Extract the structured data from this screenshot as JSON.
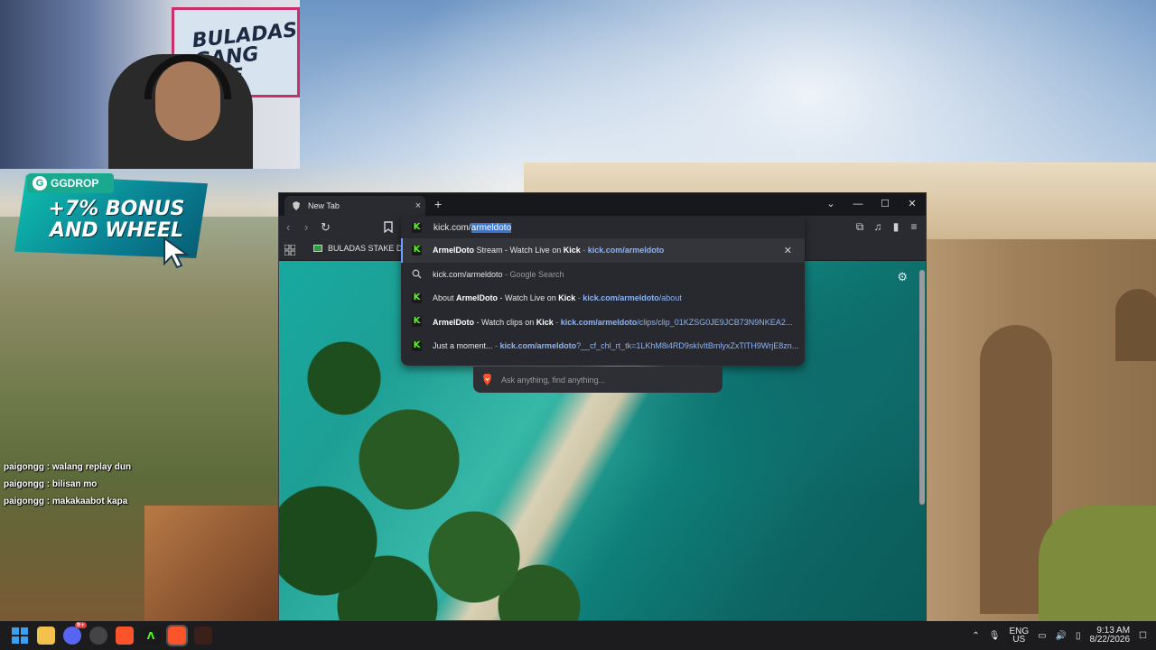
{
  "overlay": {
    "promo_brand": "GGDROP",
    "promo_text": "+7% BONUS AND WHEEL",
    "webcam_graffiti": "BULADAS GANG LIFE",
    "chat": [
      {
        "user": "paigongg",
        "message": "walang replay dun"
      },
      {
        "user": "paigongg",
        "message": "bilisan mo"
      },
      {
        "user": "paigongg",
        "message": "makakaabot kapa"
      }
    ]
  },
  "browser": {
    "tab_title": "New Tab",
    "tab_close": "×",
    "new_tab": "+",
    "window_controls": [
      "⌄",
      "—",
      "☐",
      "✕"
    ],
    "bookmark_item": "BULADAS STAKE DA...",
    "address": {
      "typed": "kick.com/",
      "autocomplete": "armeldoto"
    },
    "suggestions": [
      {
        "icon": "kick-icon",
        "bold_title": "ArmelDoto",
        "title_rest": " Stream - Watch Live on ",
        "bold_site": "Kick",
        "sep": " - ",
        "url": "kick.com/armeldoto",
        "active": true
      },
      {
        "icon": "search-icon",
        "text": "kick.com/armeldoto",
        "suffix": " - Google Search"
      },
      {
        "icon": "kick-icon",
        "pre": "About ",
        "bold_title": "ArmelDoto",
        "title_rest": " - Watch Live on ",
        "bold_site": "Kick",
        "sep": " - ",
        "url_bold": "kick.com/armeldoto",
        "url_rest": "/about"
      },
      {
        "icon": "kick-icon",
        "bold_title": "ArmelDoto",
        "title_rest": " - Watch clips on ",
        "bold_site": "Kick",
        "sep": " - ",
        "url_bold": "kick.com/armeldoto",
        "url_rest": "/clips/clip_01KZSG0JE9JCB73N9NKEA2..."
      },
      {
        "icon": "kick-icon",
        "pre": "Just a moment...",
        "sep": " - ",
        "url_bold": "kick.com/armeldoto",
        "url_rest": "?__cf_chl_rt_tk=1LKhM8i4RD9skIvItBmlyxZxTlTH9WrjE8zn..."
      }
    ],
    "ai_placeholder": "Ask anything, find anything..."
  },
  "taskbar": {
    "language_top": "ENG",
    "language_bottom": "US",
    "time": "9:13 AM",
    "date": "8/22/2026",
    "discord_badge": "9+"
  }
}
